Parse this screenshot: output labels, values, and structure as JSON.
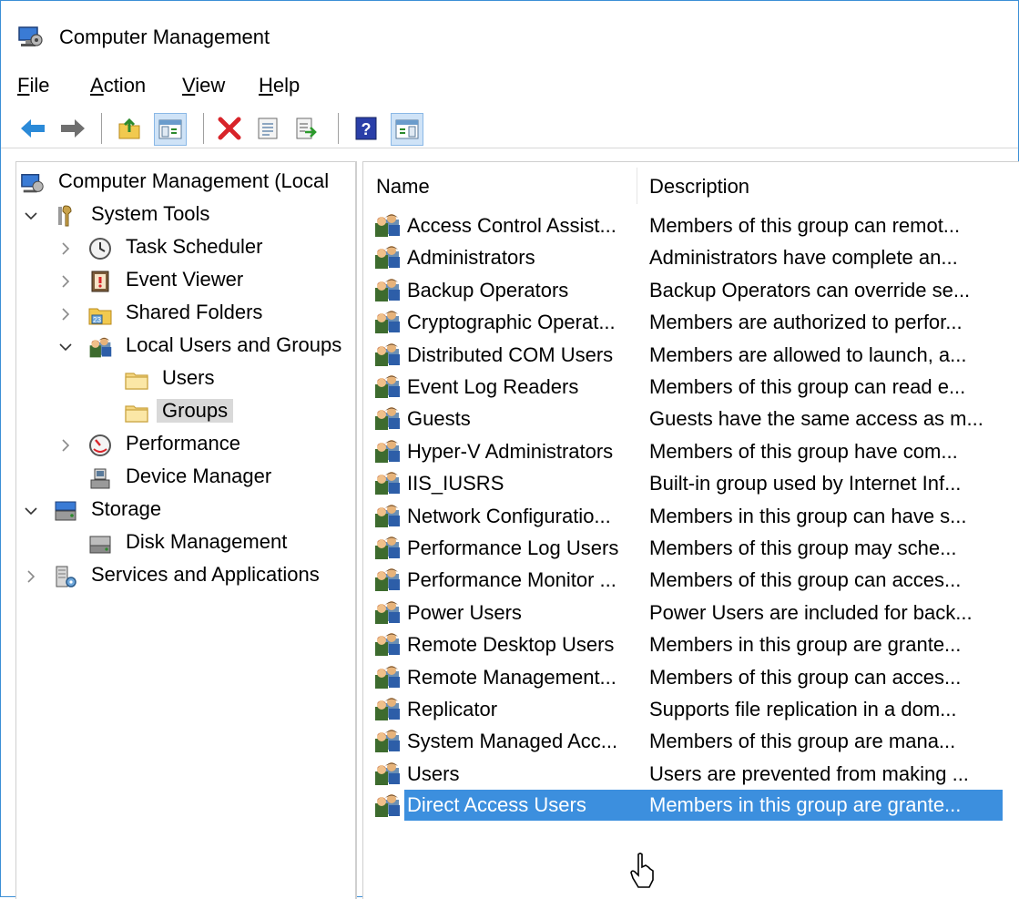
{
  "window": {
    "title": "Computer Management",
    "app_icon": "computer-management-icon"
  },
  "menu": {
    "file": {
      "accel": "F",
      "rest": "ile"
    },
    "action": {
      "accel": "A",
      "rest": "ction"
    },
    "view": {
      "accel": "V",
      "rest": "iew"
    },
    "help": {
      "accel": "H",
      "rest": "elp"
    }
  },
  "toolbar": {
    "buttons": [
      "back-arrow-icon",
      "forward-arrow-icon",
      "up-folder-icon",
      "show-hide-console-tree-icon",
      "delete-icon",
      "properties-icon",
      "export-list-icon",
      "help-icon",
      "show-hide-action-pane-icon"
    ]
  },
  "tree": {
    "root": "Computer Management (Local",
    "system_tools": "System Tools",
    "task_scheduler": "Task Scheduler",
    "event_viewer": "Event Viewer",
    "shared_folders": "Shared Folders",
    "local_users_groups": "Local Users and Groups",
    "users": "Users",
    "groups": "Groups",
    "performance": "Performance",
    "device_manager": "Device Manager",
    "storage": "Storage",
    "disk_management": "Disk Management",
    "services_apps": "Services and Applications",
    "selected": "Groups"
  },
  "list": {
    "columns": {
      "name": "Name",
      "description": "Description"
    },
    "rows": [
      {
        "name": "Access Control Assist...",
        "description": "Members of this group can remot..."
      },
      {
        "name": "Administrators",
        "description": "Administrators have complete an..."
      },
      {
        "name": "Backup Operators",
        "description": "Backup Operators can override se..."
      },
      {
        "name": "Cryptographic Operat...",
        "description": "Members are authorized to perfor..."
      },
      {
        "name": "Distributed COM Users",
        "description": "Members are allowed to launch, a..."
      },
      {
        "name": "Event Log Readers",
        "description": "Members of this group can read e..."
      },
      {
        "name": "Guests",
        "description": "Guests have the same access as m..."
      },
      {
        "name": "Hyper-V Administrators",
        "description": "Members of this group have com..."
      },
      {
        "name": "IIS_IUSRS",
        "description": "Built-in group used by Internet Inf..."
      },
      {
        "name": "Network Configuratio...",
        "description": "Members in this group can have s..."
      },
      {
        "name": "Performance Log Users",
        "description": "Members of this group may sche..."
      },
      {
        "name": "Performance Monitor ...",
        "description": "Members of this group can acces..."
      },
      {
        "name": "Power Users",
        "description": "Power Users are included for back..."
      },
      {
        "name": "Remote Desktop Users",
        "description": "Members in this group are grante..."
      },
      {
        "name": "Remote Management...",
        "description": "Members of this group can acces..."
      },
      {
        "name": "Replicator",
        "description": "Supports file replication in a dom..."
      },
      {
        "name": "System Managed Acc...",
        "description": "Members of this group are mana..."
      },
      {
        "name": "Users",
        "description": "Users are prevented from making ..."
      },
      {
        "name": "Direct Access Users",
        "description": "Members in this group are grante..."
      }
    ],
    "selected_row": "Direct Access Users"
  },
  "colors": {
    "selection": "#3c8fde",
    "tree_selected": "#d9d9d9",
    "window_border": "#3c8fd6"
  }
}
